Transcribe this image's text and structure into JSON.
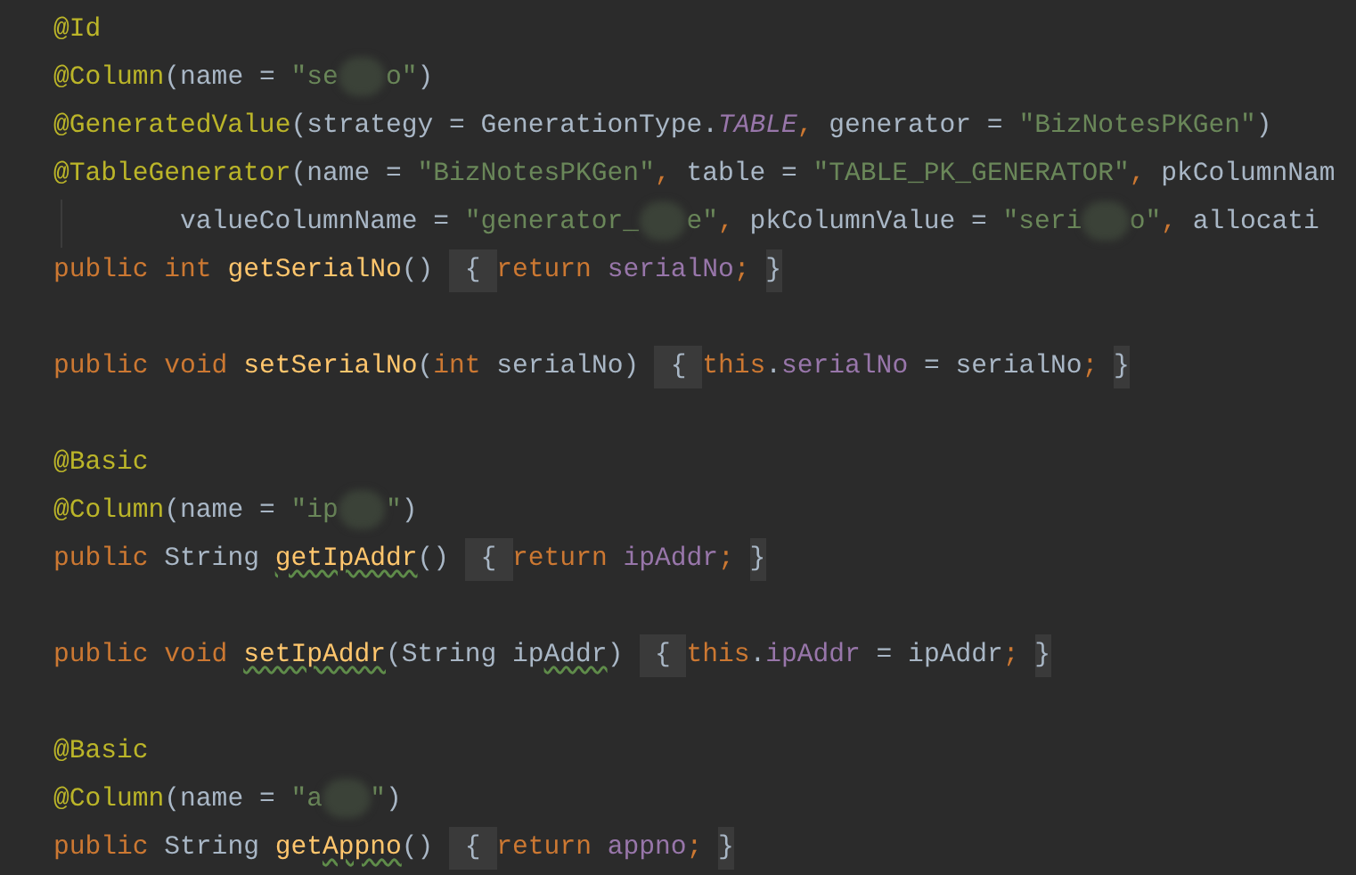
{
  "editor": {
    "lines": [
      {
        "kind": "code",
        "tokens": [
          {
            "kind": "ann",
            "text": "@Id"
          }
        ]
      },
      {
        "kind": "code",
        "tokens": [
          {
            "kind": "ann",
            "text": "@Column"
          },
          {
            "kind": "plain",
            "text": "(name = "
          },
          {
            "kind": "str",
            "text": "\"se"
          },
          {
            "kind": "redacted"
          },
          {
            "kind": "str",
            "text": "o\""
          },
          {
            "kind": "plain",
            "text": ")"
          }
        ]
      },
      {
        "kind": "code",
        "tokens": [
          {
            "kind": "ann",
            "text": "@GeneratedValue"
          },
          {
            "kind": "plain",
            "text": "(strategy = GenerationType."
          },
          {
            "kind": "const",
            "text": "TABLE"
          },
          {
            "kind": "kw",
            "text": ", "
          },
          {
            "kind": "plain",
            "text": "generator = "
          },
          {
            "kind": "str",
            "text": "\"BizNotesPKGen\""
          },
          {
            "kind": "plain",
            "text": ")"
          }
        ]
      },
      {
        "kind": "code",
        "tokens": [
          {
            "kind": "ann",
            "text": "@TableGenerator"
          },
          {
            "kind": "plain",
            "text": "(name = "
          },
          {
            "kind": "str",
            "text": "\"BizNotesPKGen\""
          },
          {
            "kind": "kw",
            "text": ", "
          },
          {
            "kind": "plain",
            "text": "table = "
          },
          {
            "kind": "str",
            "text": "\"TABLE_PK_GENERATOR\""
          },
          {
            "kind": "kw",
            "text": ", "
          },
          {
            "kind": "plain",
            "text": "pkColumnNam"
          }
        ]
      },
      {
        "kind": "code",
        "tokens": [
          {
            "kind": "indent"
          },
          {
            "kind": "plain",
            "text": "valueColumnName = "
          },
          {
            "kind": "str",
            "text": "\"generator_"
          },
          {
            "kind": "redacted"
          },
          {
            "kind": "str",
            "text": "e\""
          },
          {
            "kind": "kw",
            "text": ", "
          },
          {
            "kind": "plain",
            "text": "pkColumnValue = "
          },
          {
            "kind": "str",
            "text": "\"seri"
          },
          {
            "kind": "redacted"
          },
          {
            "kind": "str",
            "text": "o\""
          },
          {
            "kind": "kw",
            "text": ", "
          },
          {
            "kind": "plain",
            "text": "allocati"
          }
        ]
      },
      {
        "kind": "code",
        "tokens": [
          {
            "kind": "kw",
            "text": "public int "
          },
          {
            "kind": "method",
            "text": "getSerialNo"
          },
          {
            "kind": "plain",
            "text": "() "
          },
          {
            "kind": "brace",
            "text": " { "
          },
          {
            "kind": "kw",
            "text": "return "
          },
          {
            "kind": "field",
            "text": "serialNo"
          },
          {
            "kind": "kw",
            "text": "; "
          },
          {
            "kind": "brace",
            "text": "}"
          }
        ]
      },
      {
        "kind": "blank"
      },
      {
        "kind": "code",
        "tokens": [
          {
            "kind": "kw",
            "text": "public void "
          },
          {
            "kind": "method",
            "text": "setSerialNo"
          },
          {
            "kind": "plain",
            "text": "("
          },
          {
            "kind": "kw",
            "text": "int "
          },
          {
            "kind": "plain",
            "text": "serialNo) "
          },
          {
            "kind": "brace",
            "text": " { "
          },
          {
            "kind": "kw",
            "text": "this"
          },
          {
            "kind": "plain",
            "text": "."
          },
          {
            "kind": "field",
            "text": "serialNo"
          },
          {
            "kind": "plain",
            "text": " = serialNo"
          },
          {
            "kind": "kw",
            "text": "; "
          },
          {
            "kind": "brace",
            "text": "}"
          }
        ]
      },
      {
        "kind": "blank"
      },
      {
        "kind": "code",
        "tokens": [
          {
            "kind": "ann",
            "text": "@Basic"
          }
        ]
      },
      {
        "kind": "code",
        "tokens": [
          {
            "kind": "ann",
            "text": "@Column"
          },
          {
            "kind": "plain",
            "text": "(name = "
          },
          {
            "kind": "str",
            "text": "\"ip"
          },
          {
            "kind": "redacted"
          },
          {
            "kind": "str",
            "text": "\""
          },
          {
            "kind": "plain",
            "text": ")"
          }
        ]
      },
      {
        "kind": "code",
        "tokens": [
          {
            "kind": "kw",
            "text": "public "
          },
          {
            "kind": "plain",
            "text": "String "
          },
          {
            "kind": "method_typo",
            "text": "getIpAddr"
          },
          {
            "kind": "plain",
            "text": "() "
          },
          {
            "kind": "brace",
            "text": " { "
          },
          {
            "kind": "kw",
            "text": "return "
          },
          {
            "kind": "field",
            "text": "ipAddr"
          },
          {
            "kind": "kw",
            "text": "; "
          },
          {
            "kind": "brace",
            "text": "}"
          }
        ]
      },
      {
        "kind": "blank"
      },
      {
        "kind": "code",
        "tokens": [
          {
            "kind": "kw",
            "text": "public void "
          },
          {
            "kind": "method_typo",
            "text": "setIpAddr"
          },
          {
            "kind": "plain",
            "text": "(String ip"
          },
          {
            "kind": "plain_typo",
            "text": "Addr"
          },
          {
            "kind": "plain",
            "text": ") "
          },
          {
            "kind": "brace",
            "text": " { "
          },
          {
            "kind": "kw",
            "text": "this"
          },
          {
            "kind": "plain",
            "text": "."
          },
          {
            "kind": "field",
            "text": "ipAddr"
          },
          {
            "kind": "plain",
            "text": " = ipAddr"
          },
          {
            "kind": "kw",
            "text": "; "
          },
          {
            "kind": "brace",
            "text": "}"
          }
        ]
      },
      {
        "kind": "blank"
      },
      {
        "kind": "code",
        "tokens": [
          {
            "kind": "ann",
            "text": "@Basic"
          }
        ]
      },
      {
        "kind": "code",
        "tokens": [
          {
            "kind": "ann",
            "text": "@Column"
          },
          {
            "kind": "plain",
            "text": "(name = "
          },
          {
            "kind": "str",
            "text": "\"a"
          },
          {
            "kind": "redacted"
          },
          {
            "kind": "str",
            "text": "\""
          },
          {
            "kind": "plain",
            "text": ")"
          }
        ]
      },
      {
        "kind": "code",
        "tokens": [
          {
            "kind": "kw",
            "text": "public "
          },
          {
            "kind": "plain",
            "text": "String "
          },
          {
            "kind": "method",
            "text": "get"
          },
          {
            "kind": "method_typo",
            "text": "Appno"
          },
          {
            "kind": "plain",
            "text": "() "
          },
          {
            "kind": "brace",
            "text": " { "
          },
          {
            "kind": "kw",
            "text": "return "
          },
          {
            "kind": "field",
            "text": "appno"
          },
          {
            "kind": "kw",
            "text": "; "
          },
          {
            "kind": "brace",
            "text": "}"
          }
        ]
      }
    ]
  }
}
